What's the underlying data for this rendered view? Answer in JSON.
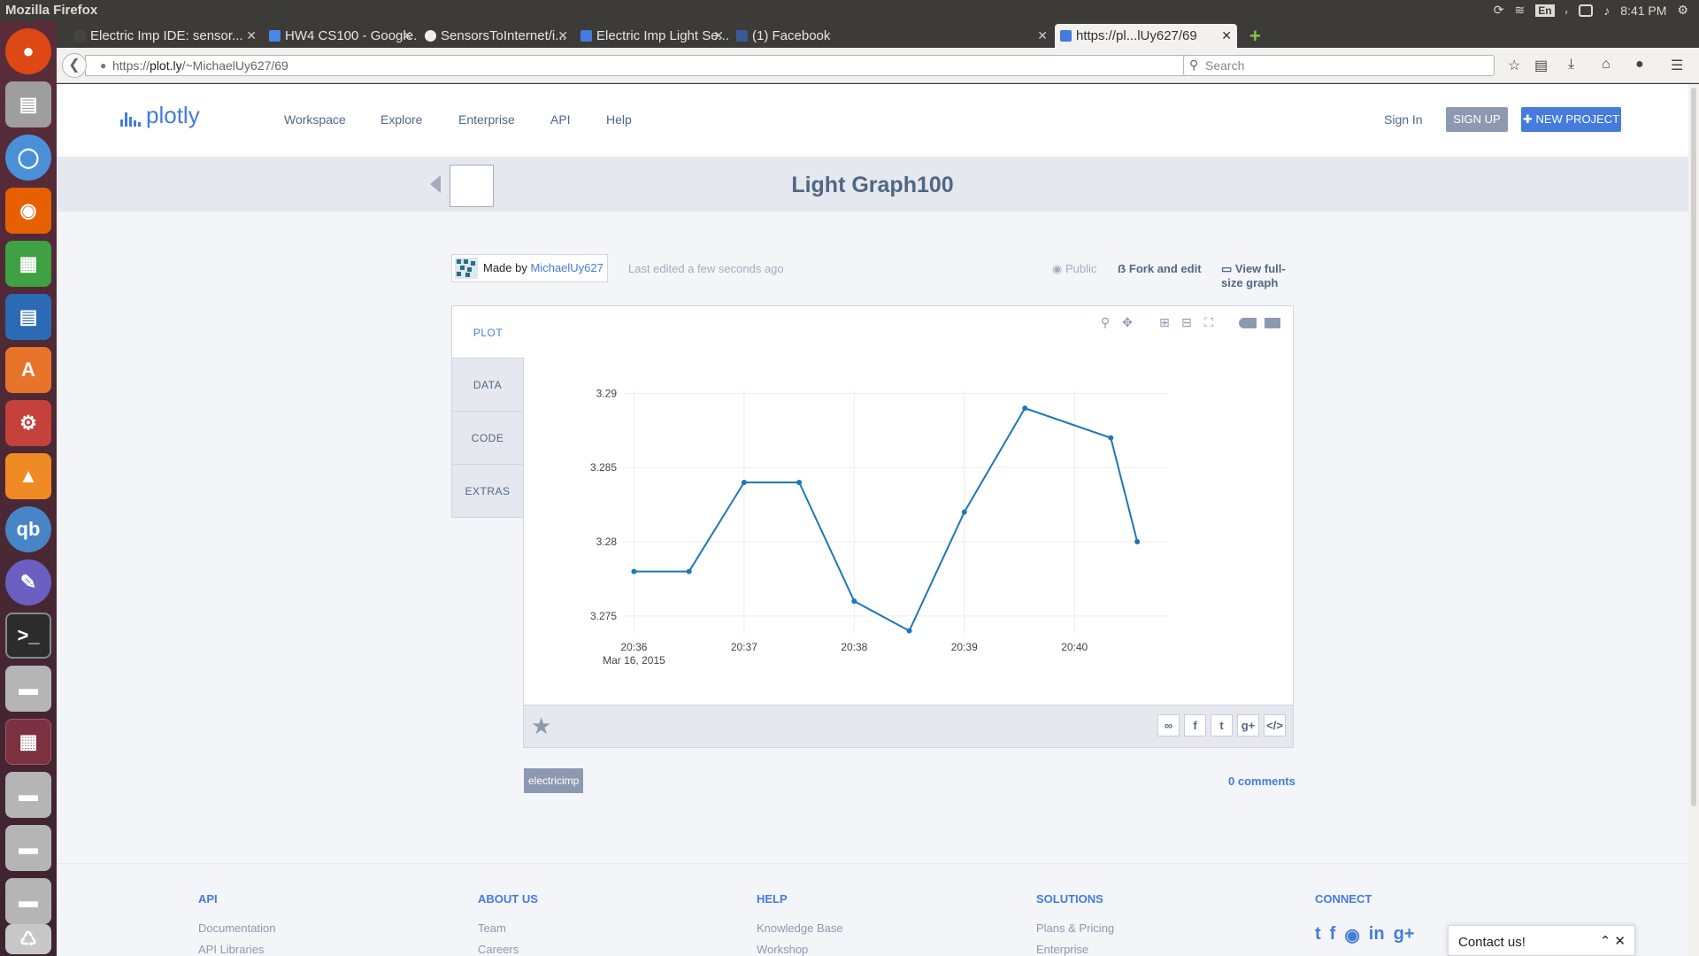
{
  "system": {
    "app_title": "Mozilla Firefox",
    "language": "En",
    "clock": "8:41 PM"
  },
  "tabs": [
    {
      "label": "Electric Imp IDE: sensor...",
      "icon": "electric-imp-icon",
      "active": false
    },
    {
      "label": "HW4 CS100 - Google...",
      "icon": "google-docs-icon",
      "active": false
    },
    {
      "label": "SensorsToInternet/i...",
      "icon": "github-icon",
      "active": false
    },
    {
      "label": "Electric Imp Light Se...",
      "icon": "plotly-icon",
      "active": false
    },
    {
      "label": "(1) Facebook",
      "icon": "facebook-icon",
      "active": false
    },
    {
      "label": "https://pl...lUy627/69",
      "icon": "plotly-icon",
      "active": true
    }
  ],
  "navbar": {
    "url_prefix": "https://",
    "url_host": "plot.ly",
    "url_path": "/~MichaelUy627/69",
    "search_placeholder": "Search"
  },
  "site": {
    "logo_text": "plotly",
    "nav": [
      "Workspace",
      "Explore",
      "Enterprise",
      "API",
      "Help"
    ],
    "sign_in": "Sign In",
    "sign_up": "SIGN UP",
    "new_project": "NEW PROJECT"
  },
  "graph": {
    "title": "Light Graph100",
    "made_by_prefix": "Made by",
    "author": "MichaelUy627",
    "last_edited": "Last edited a few seconds ago",
    "visibility": "Public",
    "fork_label": "Fork and edit",
    "fullsize_label": "View full-size graph",
    "side_tabs": [
      "PLOT",
      "DATA",
      "CODE",
      "EXTRAS"
    ],
    "tag": "electricimp",
    "comments": "0 comments"
  },
  "chart_data": {
    "type": "line",
    "title": "",
    "xlabel": "",
    "ylabel": "",
    "x_tick_labels": [
      "20:36",
      "20:37",
      "20:38",
      "20:39",
      "20:40"
    ],
    "x_date_label": "Mar 16, 2015",
    "x": [
      "2015-03-16 20:36:00",
      "2015-03-16 20:36:30",
      "2015-03-16 20:37:00",
      "2015-03-16 20:37:30",
      "2015-03-16 20:38:00",
      "2015-03-16 20:38:30",
      "2015-03-16 20:39:00",
      "2015-03-16 20:39:30",
      "2015-03-16 20:40:20",
      "2015-03-16 20:40:35"
    ],
    "x_minutes": [
      36.0,
      36.5,
      37.0,
      37.5,
      38.0,
      38.5,
      39.0,
      39.55,
      40.33,
      40.57
    ],
    "values": [
      3.278,
      3.278,
      3.284,
      3.284,
      3.276,
      3.274,
      3.282,
      3.289,
      3.287,
      3.28
    ],
    "y_ticks": [
      3.275,
      3.28,
      3.285,
      3.29
    ],
    "ylim": [
      3.2738,
      3.2902
    ],
    "xlim_minutes": [
      35.9,
      40.85
    ],
    "grid": true,
    "line_color": "#1f77b4"
  },
  "footer": {
    "columns": [
      {
        "heading": "API",
        "links": [
          "Documentation",
          "API Libraries"
        ]
      },
      {
        "heading": "ABOUT US",
        "links": [
          "Team",
          "Careers"
        ]
      },
      {
        "heading": "HELP",
        "links": [
          "Knowledge Base",
          "Workshop"
        ]
      },
      {
        "heading": "SOLUTIONS",
        "links": [
          "Plans & Pricing",
          "Enterprise"
        ]
      },
      {
        "heading": "CONNECT",
        "links": []
      }
    ],
    "contact": "Contact us!"
  },
  "colors": {
    "brand": "#447bdc",
    "text_muted": "#506784"
  }
}
